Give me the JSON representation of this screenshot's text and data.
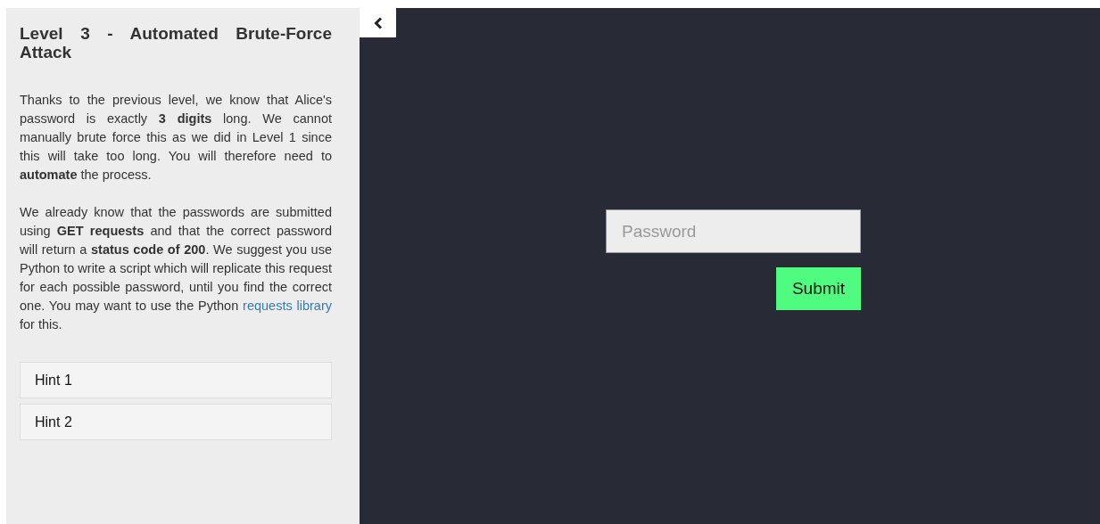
{
  "sidebar": {
    "title": "Level 3 - Automated Brute-Force Attack",
    "paragraphs": [
      {
        "text": "Thanks to the previous level, we know that Alice's password is exactly **3 digits** long. We cannot manually brute force this as we did in Level 1 since this will take too long. You will therefore need to **automate** the process."
      },
      {
        "text": "We already know that the passwords are submitted using **GET requests** and that the correct password will return a **status code of 200**. We suggest you use Python to write a script which will replicate this request for each possible password, until you find the correct one. You may want to use the Python ",
        "link": "requests library",
        "after": " for this."
      }
    ],
    "hints": [
      {
        "label": "Hint 1",
        "expanded": false
      },
      {
        "label": "Hint 2",
        "expanded": false
      }
    ]
  },
  "form": {
    "password": {
      "placeholder": "Password"
    },
    "submit": "Submit"
  }
}
